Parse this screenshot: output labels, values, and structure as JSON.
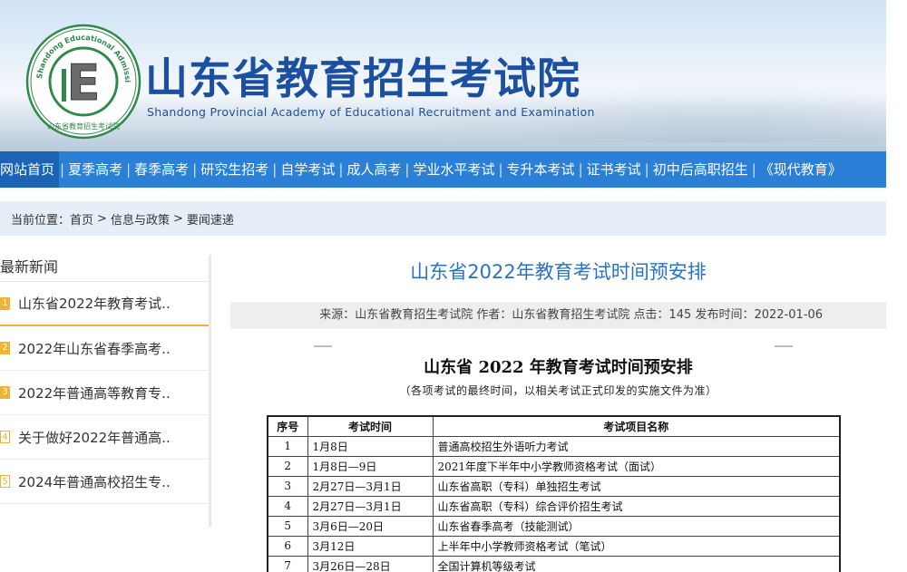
{
  "header": {
    "title": "山东省教育招生考试院",
    "subtitle": "Shandong Provincial Academy of Educational Recruitment and Examination",
    "seal_text": "Shandong Educational Admission & Examinations",
    "seal_letter": "E",
    "seal_bottom": "山东省教育招生考试院",
    "colors": {
      "brand": "#1d4fa0",
      "seal_green": "#2f8a4a"
    }
  },
  "nav": {
    "items": [
      "网站首页",
      "夏季高考",
      "春季高考",
      "研究生招考",
      "自学考试",
      "成人高考",
      "学业水平考试",
      "专升本考试",
      "证书考试",
      "初中后高职招生",
      "《现代教育》"
    ],
    "separator": "|",
    "colors": {
      "bar": "#2a7fd6",
      "active": "#1b63b5"
    }
  },
  "breadcrumb": {
    "label": "当前位置：",
    "items": [
      "首页",
      "信息与政策",
      "要闻速递"
    ],
    "separator": ">"
  },
  "sidebar": {
    "title": "最新新闻",
    "items": [
      {
        "num": "1",
        "text": "山东省2022年教育考试.."
      },
      {
        "num": "2",
        "text": "2022年山东省春季高考.."
      },
      {
        "num": "3",
        "text": "2022年普通高等教育专.."
      },
      {
        "num": "4",
        "text": "关于做好2022年普通高.."
      },
      {
        "num": "5",
        "text": "2024年普通高校招生专.."
      }
    ],
    "colors": {
      "accent": "#f2b233"
    }
  },
  "article": {
    "title": "山东省2022年教育考试时间预安排",
    "meta": "来源：山东省教育招生考试院 作者：山东省教育招生考试院 点击：145 发布时间：2022-01-06",
    "doc_title": "山东省 2022 年教育考试时间预安排",
    "doc_note": "（各项考试的最终时间，以相关考试正式印发的实施文件为准）",
    "table": {
      "headers": [
        "序号",
        "考试时间",
        "考试项目名称"
      ],
      "rows": [
        [
          "1",
          "1月8日",
          "普通高校招生外语听力考试"
        ],
        [
          "2",
          "1月8日—9日",
          "2021年度下半年中小学教师资格考试（面试）"
        ],
        [
          "3",
          "2月27日—3月1日",
          "山东省高职（专科）单独招生考试"
        ],
        [
          "4",
          "2月27日—3月1日",
          "山东省高职（专科）综合评价招生考试"
        ],
        [
          "5",
          "3月6日—20日",
          "山东省春季高考（技能测试）"
        ],
        [
          "6",
          "3月12日",
          "上半年中小学教师资格考试（笔试）"
        ],
        [
          "7",
          "3月26日—28日",
          "全国计算机等级考试"
        ]
      ]
    }
  }
}
